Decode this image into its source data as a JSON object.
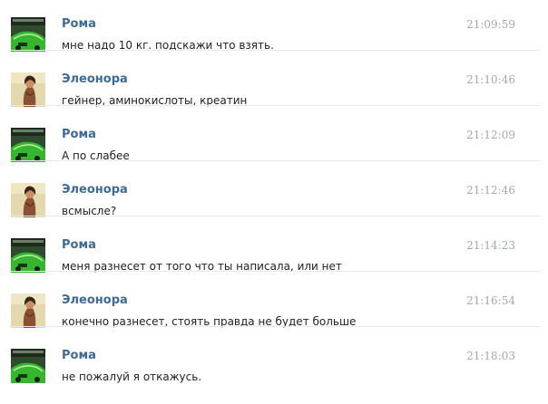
{
  "messages": [
    {
      "sender": "Рома",
      "time": "21:09:59",
      "text": "мне надо 10 кг. подскажи что взять.",
      "avatar": "car-icon"
    },
    {
      "sender": "Элеонора",
      "time": "21:10:46",
      "text": "гейнер, аминокислоты, креатин",
      "avatar": "portrait-icon"
    },
    {
      "sender": "Рома",
      "time": "21:12:09",
      "text": "А по слабее",
      "avatar": "car-icon"
    },
    {
      "sender": "Элеонора",
      "time": "21:12:46",
      "text": "всмысле?",
      "avatar": "portrait-icon"
    },
    {
      "sender": "Рома",
      "time": "21:14:23",
      "text": "меня разнесет от того что ты написала, или нет",
      "avatar": "car-icon"
    },
    {
      "sender": "Элеонора",
      "time": "21:16:54",
      "text": "конечно разнесет, стоять правда не будет больше",
      "avatar": "portrait-icon"
    },
    {
      "sender": "Рома",
      "time": "21:18:03",
      "text": "не пожалуй я откажусь.",
      "avatar": "car-icon"
    }
  ],
  "colors": {
    "sender_name": "#3d6a96",
    "timestamp": "#a3a9b0",
    "message_text": "#1f1f1f"
  }
}
